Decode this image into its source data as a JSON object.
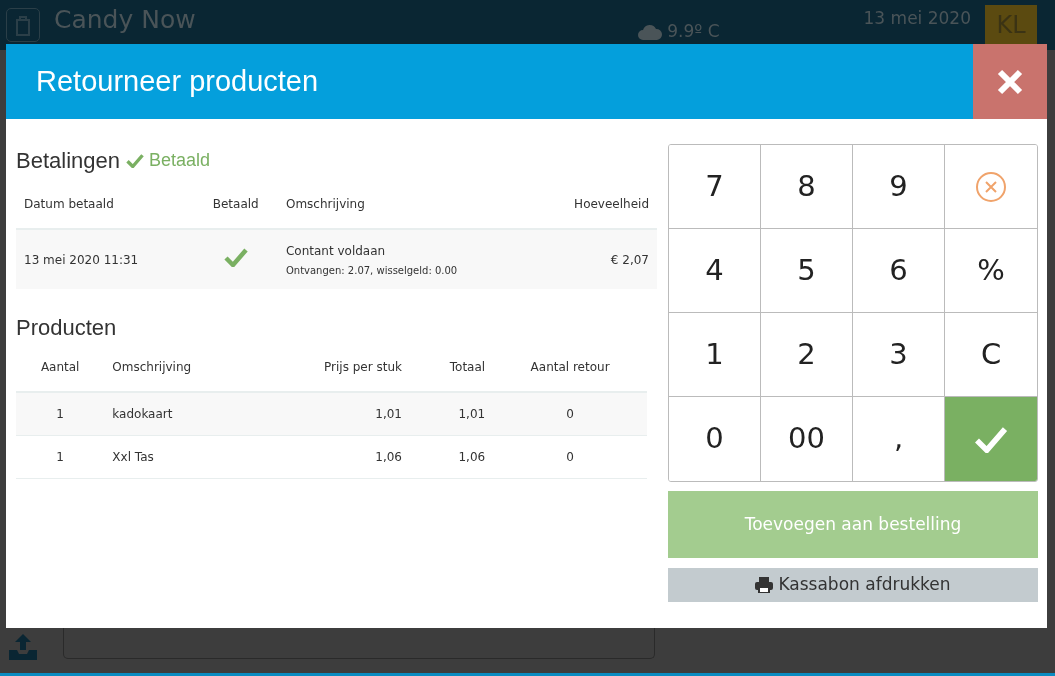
{
  "background_app": {
    "title": "Candy Now",
    "weather": "9.9º C",
    "date": "13 mei 2020",
    "user_initials": "KL"
  },
  "modal": {
    "title": "Retourneer producten",
    "payments": {
      "heading": "Betalingen",
      "status": {
        "label": "Betaald",
        "paid": true
      },
      "columns": [
        "Datum betaald",
        "Betaald",
        "Omschrijving",
        "Hoeveelheid"
      ],
      "rows": [
        {
          "date": "13 mei 2020 11:31",
          "paid": true,
          "description": "Contant voldaan",
          "detail": "Ontvangen: 2.07, wisselgeld: 0.00",
          "amount": "€ 2,07"
        }
      ]
    },
    "products": {
      "heading": "Producten",
      "columns": [
        "Aantal",
        "Omschrijving",
        "Prijs per stuk",
        "Totaal",
        "Aantal retour"
      ],
      "rows": [
        [
          "1",
          "kadokaart",
          "1,01",
          "1,01",
          "0"
        ],
        [
          "1",
          "Xxl Tas",
          "1,06",
          "1,06",
          "0"
        ]
      ]
    },
    "keypad": [
      {
        "kind": "key",
        "label": "7"
      },
      {
        "kind": "key",
        "label": "8"
      },
      {
        "kind": "key",
        "label": "9"
      },
      {
        "kind": "cancel"
      },
      {
        "kind": "key",
        "label": "4"
      },
      {
        "kind": "key",
        "label": "5"
      },
      {
        "kind": "key",
        "label": "6"
      },
      {
        "kind": "key",
        "label": "%"
      },
      {
        "kind": "key",
        "label": "1"
      },
      {
        "kind": "key",
        "label": "2"
      },
      {
        "kind": "key",
        "label": "3"
      },
      {
        "kind": "key",
        "label": "C"
      },
      {
        "kind": "key",
        "label": "0"
      },
      {
        "kind": "key",
        "label": "00"
      },
      {
        "kind": "key",
        "label": ","
      },
      {
        "kind": "confirm"
      }
    ],
    "add_button": {
      "label": "Toevoegen aan bestelling",
      "disabled": true
    },
    "print_button": {
      "label": "Kassabon afdrukken"
    }
  }
}
